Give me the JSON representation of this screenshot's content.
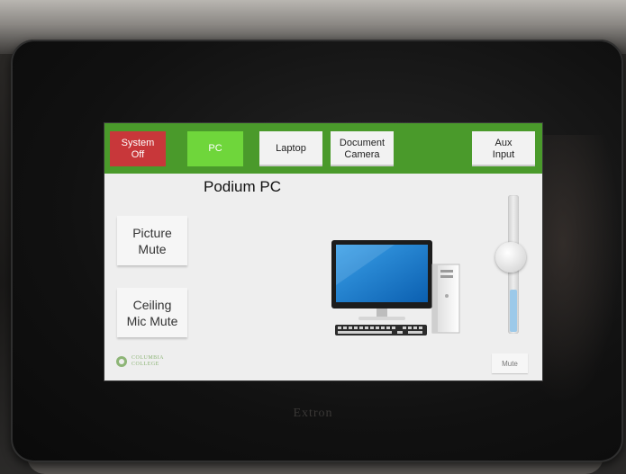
{
  "device": {
    "brand": "Extron"
  },
  "topbar": {
    "buttons": [
      {
        "label": "System\nOff",
        "state": "off"
      },
      {
        "label": "PC",
        "state": "selected"
      },
      {
        "label": "Laptop",
        "state": "normal"
      },
      {
        "label": "Document\nCamera",
        "state": "normal"
      },
      {
        "label": "Aux\nInput",
        "state": "normal"
      }
    ]
  },
  "main": {
    "title": "Podium PC",
    "side_buttons": [
      {
        "label": "Picture\nMute"
      },
      {
        "label": "Ceiling\nMic Mute"
      }
    ]
  },
  "volume": {
    "level": 0.55,
    "mute_label": "Mute"
  },
  "logo": {
    "lettering": "COLUMBIA\nCOLLEGE"
  },
  "colors": {
    "topbar_green": "#4a9a2b",
    "system_off_red": "#c8373a",
    "selected_source_green": "#6fd63b",
    "volume_fill_blue": "#9cc9e9"
  },
  "icons": {
    "source_illustration": "desktop-computer-icon",
    "logo": "school-seal-icon"
  }
}
